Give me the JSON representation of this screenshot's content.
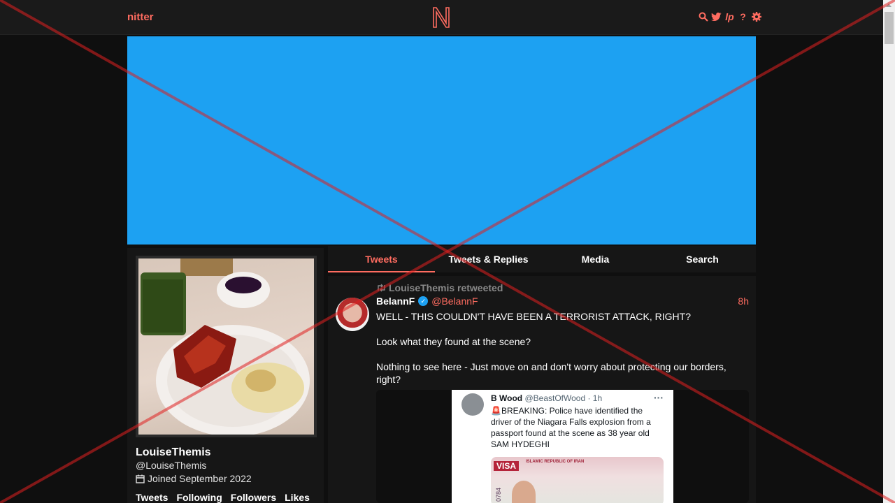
{
  "navbar": {
    "brand": "nitter",
    "icons": [
      "search-icon",
      "twitter-bird-icon",
      "lp-icon",
      "question-icon",
      "gear-icon"
    ],
    "question_glyph": "?",
    "lp_glyph": "lp"
  },
  "profile": {
    "fullname": "LouiseThemis",
    "username": "@LouiseThemis",
    "joined": "Joined September 2022",
    "stats": [
      "Tweets",
      "Following",
      "Followers",
      "Likes"
    ],
    "banner_color": "#1da1f2"
  },
  "tabs": [
    "Tweets",
    "Tweets & Replies",
    "Media",
    "Search"
  ],
  "tweet": {
    "retweet_header": "LouiseThemis retweeted",
    "fullname": "BelannF",
    "username": "@BelannF",
    "date": "8h",
    "paragraphs": [
      "WELL - THIS COULDN'T HAVE BEEN A TERRORIST ATTACK, RIGHT?",
      "Look what they found at the scene?",
      "Nothing to see here - Just move on and don't worry about protecting our borders, right?"
    ],
    "embed": {
      "name": "B Wood",
      "handle": "@BeastOfWood · 1h",
      "dots": "···",
      "text": "🚨BREAKING:  Police have identified the driver of the Niagara Falls explosion from a passport found at the scene as 38 year old SAM HYDEGHI",
      "visa_label": "VISA",
      "visa_rep": "ISLAMIC REPUBLIC OF IRAN",
      "visa_num": "0784"
    }
  },
  "colors": {
    "accent": "#ff6c60",
    "background": "#0f0f0f",
    "panel": "#161616",
    "verified": "#1da1f2"
  }
}
